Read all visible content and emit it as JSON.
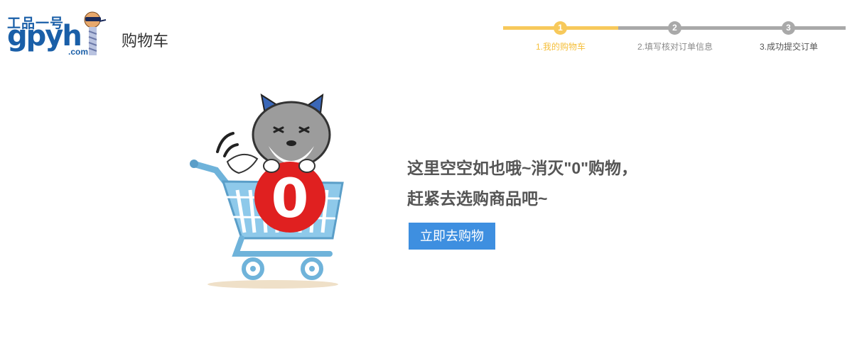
{
  "logo": {
    "top_text": "工品一号",
    "main_text": "gpyh",
    "com_text": ".com"
  },
  "header": {
    "title": "购物车"
  },
  "steps": [
    {
      "number": "1",
      "label": "1.我的购物车",
      "state": "active"
    },
    {
      "number": "2",
      "label": "2.填写核对订单信息",
      "state": "inactive"
    },
    {
      "number": "3",
      "label": "3.成功提交订单",
      "state": "inactive"
    }
  ],
  "colors": {
    "active": "#f7c95b",
    "inactive": "#a9a9a9",
    "button": "#3e8fe0",
    "badge": "#e02020"
  },
  "illustration": {
    "badge_text": "0"
  },
  "empty_cart": {
    "line1": "这里空空如也哦~消灭\"0\"购物，",
    "line2": "赶紧去选购商品吧~",
    "button_label": "立即去购物"
  }
}
